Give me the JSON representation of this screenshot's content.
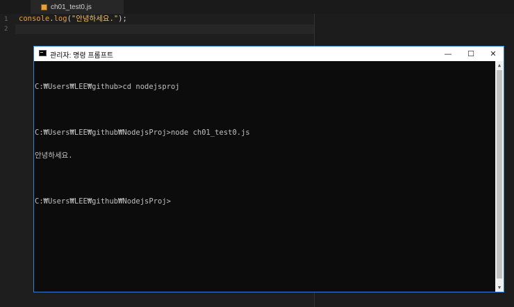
{
  "editor": {
    "tab_label": "ch01_test0.js",
    "line_numbers": [
      "1",
      "2"
    ],
    "code": {
      "obj": "console",
      "dot": ".",
      "fn": "log",
      "open": "(",
      "str": "\"안녕하세요.\"",
      "close": ");"
    }
  },
  "console_window": {
    "title": "관리자: 명령 프롬프트",
    "buttons": {
      "minimize": "—",
      "maximize": "☐",
      "close": "✕"
    },
    "lines": [
      "C:₩Users₩LEE₩github>cd nodejsproj",
      "",
      "C:₩Users₩LEE₩github₩NodejsProj>node ch01_test0.js",
      "안녕하세요.",
      "",
      "C:₩Users₩LEE₩github₩NodejsProj>"
    ]
  },
  "colors": {
    "accent": "#3a7fd5",
    "console_bg": "#0c0c0c",
    "console_fg": "#c0c0c0",
    "editor_bg": "#1e1e1e",
    "keyword": "#e3a33a"
  }
}
